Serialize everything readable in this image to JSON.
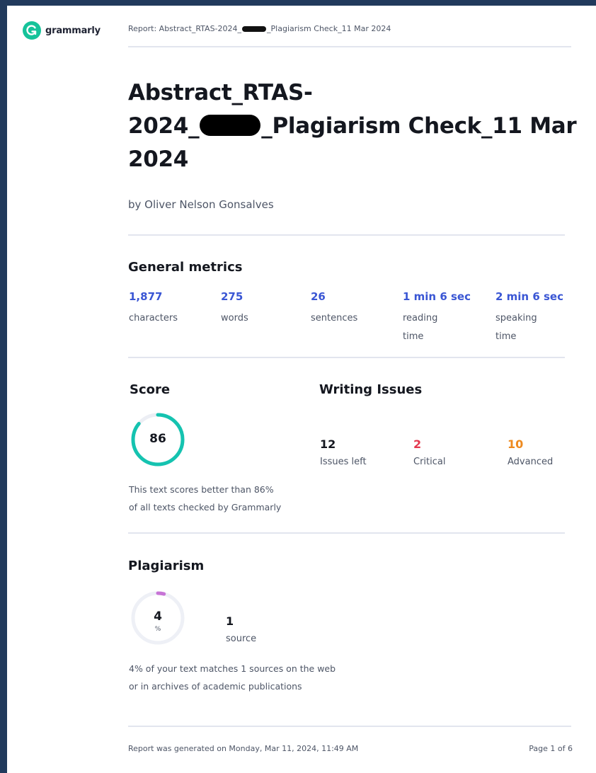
{
  "brand": {
    "name": "grammarly",
    "color": "#15c39a"
  },
  "header": {
    "report_prefix": "Report: Abstract_RTAS-2024_",
    "report_suffix": "_Plagiarism Check_11 Mar 2024"
  },
  "document": {
    "title_line1": "Abstract_RTAS-",
    "title_line2_prefix": "2024_",
    "title_line2_suffix": "_Plagiarism Check_11 Mar",
    "title_line3": "2024",
    "author": "by Oliver Nelson Gonsalves"
  },
  "general_metrics": {
    "heading": "General metrics",
    "items": [
      {
        "value": "1,877",
        "label": "characters"
      },
      {
        "value": "275",
        "label": "words"
      },
      {
        "value": "26",
        "label": "sentences"
      },
      {
        "value": "1 min 6 sec",
        "label": "reading time"
      },
      {
        "value": "2 min 6 sec",
        "label": "speaking time"
      }
    ],
    "value_color": "#3a56d4"
  },
  "score": {
    "heading": "Score",
    "value": "86",
    "percent": 86,
    "color": "#15c3b0",
    "note_line1": "This text scores better than 86%",
    "note_line2": "of all texts checked by Grammarly"
  },
  "writing_issues": {
    "heading": "Writing Issues",
    "items": [
      {
        "value": "12",
        "label": "Issues left",
        "color": "#14171f"
      },
      {
        "value": "2",
        "label": "Critical",
        "color": "#e4384e"
      },
      {
        "value": "10",
        "label": "Advanced",
        "color": "#ee8a1f"
      }
    ]
  },
  "plagiarism": {
    "heading": "Plagiarism",
    "value": "4",
    "unit": "%",
    "percent": 4,
    "color": "#c774d6",
    "sources_value": "1",
    "sources_label": "source",
    "note_line1": "4% of your text matches 1 sources on the web",
    "note_line2": "or in archives of academic publications"
  },
  "footer": {
    "generated": "Report was generated on Monday, Mar 11, 2024, 11:49 AM",
    "page": "Page 1 of 6"
  }
}
